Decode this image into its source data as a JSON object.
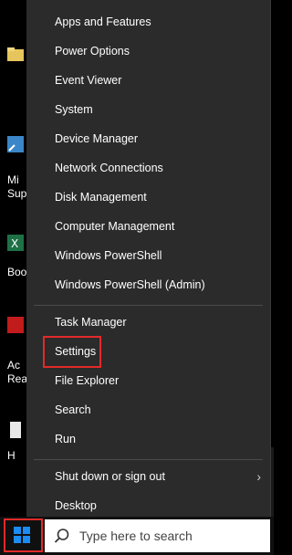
{
  "desktop": {
    "items": [
      {
        "label": "Mi"
      },
      {
        "label": "Sup"
      },
      {
        "label": "Boo"
      },
      {
        "label": "Ac"
      },
      {
        "label": "Rea"
      },
      {
        "label": "H"
      }
    ]
  },
  "context_menu": {
    "group1": [
      {
        "label": "Apps and Features"
      },
      {
        "label": "Power Options"
      },
      {
        "label": "Event Viewer"
      },
      {
        "label": "System"
      },
      {
        "label": "Device Manager"
      },
      {
        "label": "Network Connections"
      },
      {
        "label": "Disk Management"
      },
      {
        "label": "Computer Management"
      },
      {
        "label": "Windows PowerShell"
      },
      {
        "label": "Windows PowerShell (Admin)"
      }
    ],
    "group2": [
      {
        "label": "Task Manager"
      },
      {
        "label": "Settings"
      },
      {
        "label": "File Explorer"
      },
      {
        "label": "Search"
      },
      {
        "label": "Run"
      }
    ],
    "group3": [
      {
        "label": "Shut down or sign out"
      },
      {
        "label": "Desktop"
      }
    ],
    "chevron": "›",
    "highlight_color": "#e22a2a"
  },
  "taskbar": {
    "search_placeholder": "Type here to search",
    "start_icon": "windows-logo-icon",
    "search_icon": "search-icon"
  }
}
